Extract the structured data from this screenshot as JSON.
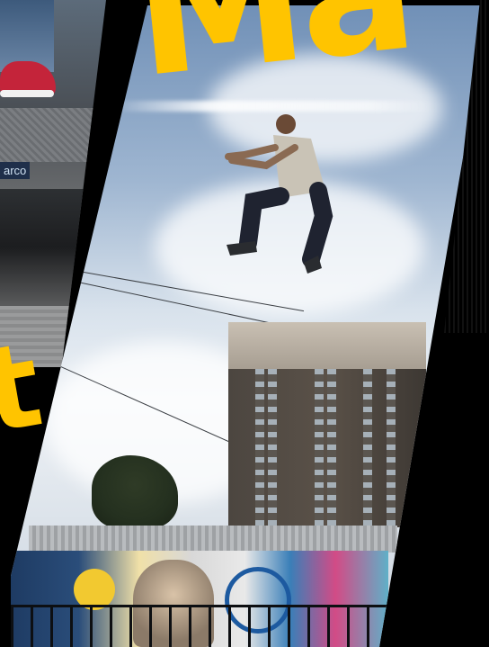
{
  "scene": {
    "type": "photo-collage",
    "subject": "person jumping",
    "background_color": "#000000"
  },
  "overlay_text": {
    "top": "Ma",
    "left": "t"
  },
  "left_panel": {
    "brand_text": "arco"
  },
  "colors": {
    "brush_yellow": "#ffc400",
    "sky_blue": "#9fb6d1",
    "shoe_red": "#c4243a"
  }
}
